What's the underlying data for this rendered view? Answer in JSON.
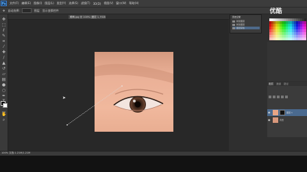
{
  "app": {
    "logo": "Ps"
  },
  "menu": {
    "items": [
      "文件(F)",
      "编辑(E)",
      "图像(I)",
      "图层(L)",
      "类型(Y)",
      "选择(S)",
      "滤镜(T)",
      "3D(D)",
      "视图(V)",
      "窗口(W)",
      "帮助(H)"
    ]
  },
  "options": {
    "items": [
      "自动选择:",
      "图层",
      "显示变换控件"
    ]
  },
  "document": {
    "tab_title": "眼睛.jpg @ 100% (图层 1, RGB/8#) ×",
    "zoom_status": "100%  文档:1.21M/1.21M"
  },
  "history": {
    "rows": [
      "历史记录",
      "新建图层",
      "新建图层",
      "图层蒙版"
    ]
  },
  "watermark": "优酷",
  "layers": {
    "tabs": [
      "图层",
      "通道",
      "路径"
    ],
    "rows": [
      {
        "name": "图层 1"
      },
      {
        "name": "背景"
      }
    ]
  },
  "colors": {
    "accent": "#5bb3ff",
    "skin": "#e8a585",
    "canvas_bg": "#282828"
  },
  "icons": [
    "move-icon",
    "marquee-icon",
    "lasso-icon",
    "quick-select-icon",
    "crop-icon",
    "eyedropper-icon",
    "healing-icon",
    "brush-icon",
    "stamp-icon",
    "history-brush-icon",
    "eraser-icon",
    "gradient-icon",
    "blur-icon",
    "dodge-icon",
    "pen-icon",
    "type-icon",
    "path-select-icon",
    "shape-icon",
    "hand-icon",
    "zoom-icon"
  ]
}
